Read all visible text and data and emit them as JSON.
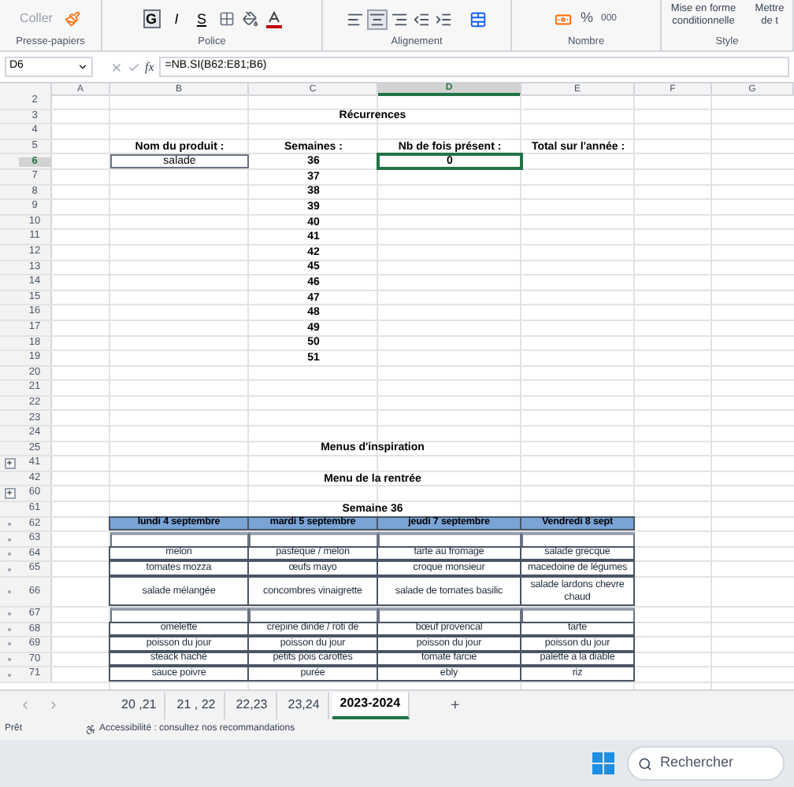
{
  "ribbon": {
    "groups": [
      {
        "kind": "clipboard",
        "label": "Presse-papiers",
        "paste": "Coller"
      },
      {
        "kind": "font",
        "label": "Police",
        "buttons": [
          {
            "text": "G",
            "selected": true
          },
          {
            "text": "I",
            "selected": false
          },
          {
            "text": "S",
            "selected": false
          }
        ]
      },
      {
        "kind": "alignment",
        "label": "Alignement",
        "buttons": [
          {
            "selected": false
          },
          {
            "selected": true
          },
          {
            "selected": false
          },
          {
            "selected": false
          },
          {
            "selected": false
          }
        ]
      },
      {
        "kind": "number",
        "label": "Nombre",
        "percent": "%",
        "thousands": "000"
      },
      {
        "kind": "styles",
        "label": "Style",
        "conditional": "Mise en forme conditionnelle",
        "table": "Mettre de t"
      }
    ]
  },
  "formula_bar": {
    "name_box": "D6",
    "function_label": "fx",
    "formula": "=NB.SI(B62:E81;B6)"
  },
  "columns": [
    {
      "label": "A",
      "selected": false
    },
    {
      "label": "B",
      "selected": false
    },
    {
      "label": "C",
      "selected": false
    },
    {
      "label": "D",
      "selected": true
    },
    {
      "label": "E",
      "selected": false
    },
    {
      "label": "F",
      "selected": false
    },
    {
      "label": "G",
      "selected": false
    }
  ],
  "rows": [
    {
      "number": "2",
      "selected": false,
      "kind": "plain"
    },
    {
      "number": "3",
      "selected": false,
      "kind": "title",
      "text": "Récurrences"
    },
    {
      "number": "4",
      "selected": false,
      "kind": "plain"
    },
    {
      "number": "5",
      "selected": false,
      "kind": "plain",
      "column_b": {
        "text": "Nom du produit :",
        "kind": "label",
        "selected": false
      },
      "column_c": {
        "text": "Semaines :",
        "kind": "label",
        "selected": false
      },
      "column_d": {
        "text": "Nb de fois présent :",
        "kind": "label",
        "selected": false
      },
      "column_e": {
        "text": "Total sur l'année :",
        "kind": "label",
        "selected": false
      }
    },
    {
      "number": "6",
      "selected": true,
      "kind": "plain",
      "column_b": {
        "text": "salade",
        "kind": "input",
        "selected": false
      },
      "column_c": {
        "text": "36",
        "kind": "label",
        "selected": false
      },
      "column_d": {
        "text": "0",
        "kind": "label",
        "selected": true
      }
    },
    {
      "number": "7",
      "selected": false,
      "kind": "plain",
      "column_c": {
        "text": "37",
        "kind": "label",
        "selected": false
      }
    },
    {
      "number": "8",
      "selected": false,
      "kind": "plain",
      "column_c": {
        "text": "38",
        "kind": "label",
        "selected": false
      }
    },
    {
      "number": "9",
      "selected": false,
      "kind": "plain",
      "column_c": {
        "text": "39",
        "kind": "label",
        "selected": false
      }
    },
    {
      "number": "10",
      "selected": false,
      "kind": "plain",
      "column_c": {
        "text": "40",
        "kind": "label",
        "selected": false
      }
    },
    {
      "number": "11",
      "selected": false,
      "kind": "plain",
      "column_c": {
        "text": "41",
        "kind": "label",
        "selected": false
      }
    },
    {
      "number": "12",
      "selected": false,
      "kind": "plain",
      "column_c": {
        "text": "42",
        "kind": "label",
        "selected": false
      }
    },
    {
      "number": "13",
      "selected": false,
      "kind": "plain",
      "column_c": {
        "text": "45",
        "kind": "label",
        "selected": false
      }
    },
    {
      "number": "14",
      "selected": false,
      "kind": "plain",
      "column_c": {
        "text": "46",
        "kind": "label",
        "selected": false
      }
    },
    {
      "number": "15",
      "selected": false,
      "kind": "plain",
      "column_c": {
        "text": "47",
        "kind": "label",
        "selected": false
      }
    },
    {
      "number": "16",
      "selected": false,
      "kind": "plain",
      "column_c": {
        "text": "48",
        "kind": "label",
        "selected": false
      }
    },
    {
      "number": "17",
      "selected": false,
      "kind": "plain",
      "column_c": {
        "text": "49",
        "kind": "label",
        "selected": false
      }
    },
    {
      "number": "18",
      "selected": false,
      "kind": "plain",
      "column_c": {
        "text": "50",
        "kind": "label",
        "selected": false
      }
    },
    {
      "number": "19",
      "selected": false,
      "kind": "plain",
      "column_c": {
        "text": "51",
        "kind": "label",
        "selected": false
      }
    },
    {
      "number": "20",
      "selected": false,
      "kind": "plain"
    },
    {
      "number": "21",
      "selected": false,
      "kind": "plain"
    },
    {
      "number": "22",
      "selected": false,
      "kind": "plain"
    },
    {
      "number": "23",
      "selected": false,
      "kind": "plain"
    },
    {
      "number": "24",
      "selected": false,
      "kind": "plain"
    },
    {
      "number": "25",
      "selected": false,
      "kind": "title",
      "text": "Menus d'inspiration"
    },
    {
      "number": "41",
      "selected": false,
      "kind": "plain",
      "group_button": "+"
    },
    {
      "number": "42",
      "selected": false,
      "kind": "title",
      "text": "Menu de la rentrée"
    },
    {
      "number": "60",
      "selected": false,
      "kind": "plain",
      "group_button": "+"
    },
    {
      "number": "61",
      "selected": false,
      "kind": "title",
      "text": "Semaine 36"
    },
    {
      "number": "62",
      "selected": false,
      "kind": "menu_header",
      "in_group": true,
      "cells": [
        "lundi 4  septembre",
        "mardi 5 septembre",
        "jeudi 7 septembre",
        "Vendredi 8 sept"
      ]
    },
    {
      "number": "63",
      "selected": false,
      "kind": "menu_blank",
      "in_group": true
    },
    {
      "number": "64",
      "selected": false,
      "kind": "menu",
      "in_group": true,
      "cells": [
        "melon",
        "pasteque / melon",
        "tarte au fromage",
        "salade grecque"
      ]
    },
    {
      "number": "65",
      "selected": false,
      "kind": "menu",
      "in_group": true,
      "cells": [
        "tomates mozza",
        "œufs mayo",
        "croque monsieur",
        "macedoine de légumes"
      ]
    },
    {
      "number": "66",
      "selected": false,
      "kind": "menu_tall",
      "in_group": true,
      "cells": [
        "salade mélangée",
        "concombres vinaigrette",
        "salade de  tomates basilic",
        "salade lardons chevre chaud"
      ]
    },
    {
      "number": "67",
      "selected": false,
      "kind": "menu_blank",
      "in_group": true
    },
    {
      "number": "68",
      "selected": false,
      "kind": "menu",
      "in_group": true,
      "cells": [
        "omelette",
        "crepine dinde  / roti de",
        "bœuf provencal",
        "tarte"
      ]
    },
    {
      "number": "69",
      "selected": false,
      "kind": "menu",
      "in_group": true,
      "cells": [
        "poisson du jour",
        "poisson du jour",
        "poisson du jour",
        "poisson du jour"
      ]
    },
    {
      "number": "70",
      "selected": false,
      "kind": "menu",
      "in_group": true,
      "cells": [
        "steack haché",
        "petits pois carottes",
        "tomate farcie",
        "palette a la diable"
      ]
    },
    {
      "number": "71",
      "selected": false,
      "kind": "menu",
      "in_group": true,
      "cells": [
        "sauce poivre",
        "purée",
        "ebly",
        "riz"
      ]
    }
  ],
  "sheet_tabs": [
    {
      "label": "20 ,21",
      "selected": false
    },
    {
      "label": "21 , 22",
      "selected": false
    },
    {
      "label": "22,23",
      "selected": false
    },
    {
      "label": "23,24",
      "selected": false
    },
    {
      "label": "2023-2024",
      "selected": true
    }
  ],
  "add_sheet": "+",
  "status_bar": {
    "mode": "Prêt",
    "accessibility": "Accessibilité : consultez nos recommandations"
  },
  "taskbar": {
    "search_placeholder": "Rechercher"
  }
}
